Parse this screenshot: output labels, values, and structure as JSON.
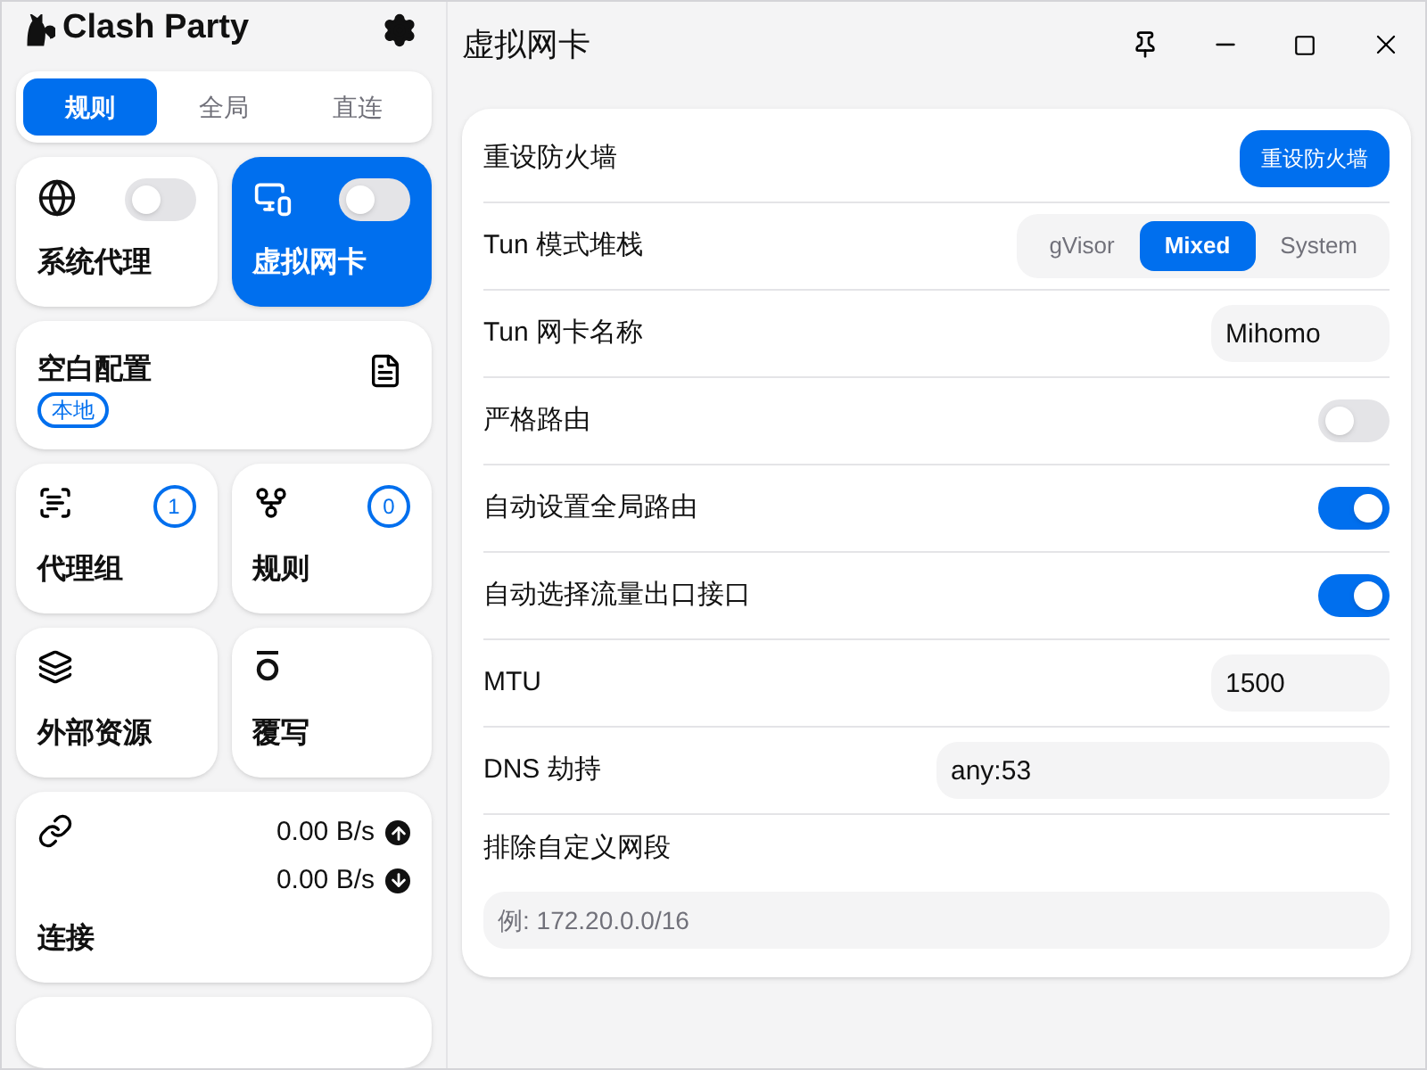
{
  "sidebar": {
    "app_title": "Clash Party",
    "modes": [
      {
        "label": "规则",
        "selected": true
      },
      {
        "label": "全局",
        "selected": false
      },
      {
        "label": "直连",
        "selected": false
      }
    ],
    "toggle_tiles": [
      {
        "label": "系统代理",
        "on": false,
        "selected": false
      },
      {
        "label": "虚拟网卡",
        "on": false,
        "selected": true
      }
    ],
    "profile": {
      "title": "空白配置",
      "badge": "本地"
    },
    "tiles": [
      {
        "kind": "count",
        "label": "代理组",
        "count": "1"
      },
      {
        "kind": "count",
        "label": "规则",
        "count": "0"
      },
      {
        "kind": "plain",
        "label": "外部资源"
      },
      {
        "kind": "plain",
        "label": "覆写"
      }
    ],
    "connections": {
      "label": "连接",
      "upload": "0.00 B/s",
      "download": "0.00 B/s"
    }
  },
  "window": {
    "title": "虚拟网卡"
  },
  "settings": [
    {
      "kind": "button",
      "label": "重设防火墙",
      "button": "重设防火墙"
    },
    {
      "kind": "segmented",
      "label": "Tun 模式堆栈",
      "options": [
        {
          "label": "gVisor",
          "selected": false
        },
        {
          "label": "Mixed",
          "selected": true
        },
        {
          "label": "System",
          "selected": false
        }
      ]
    },
    {
      "kind": "input",
      "label": "Tun 网卡名称",
      "value": "Mihomo"
    },
    {
      "kind": "toggle",
      "label": "严格路由",
      "on": false
    },
    {
      "kind": "toggle",
      "label": "自动设置全局路由",
      "on": true
    },
    {
      "kind": "toggle",
      "label": "自动选择流量出口接口",
      "on": true
    },
    {
      "kind": "input",
      "label": "MTU",
      "value": "1500"
    },
    {
      "kind": "wide_input",
      "label": "DNS 劫持",
      "value": "any:53"
    },
    {
      "kind": "block_input",
      "label": "排除自定义网段",
      "placeholder": "例: 172.20.0.0/16"
    }
  ]
}
